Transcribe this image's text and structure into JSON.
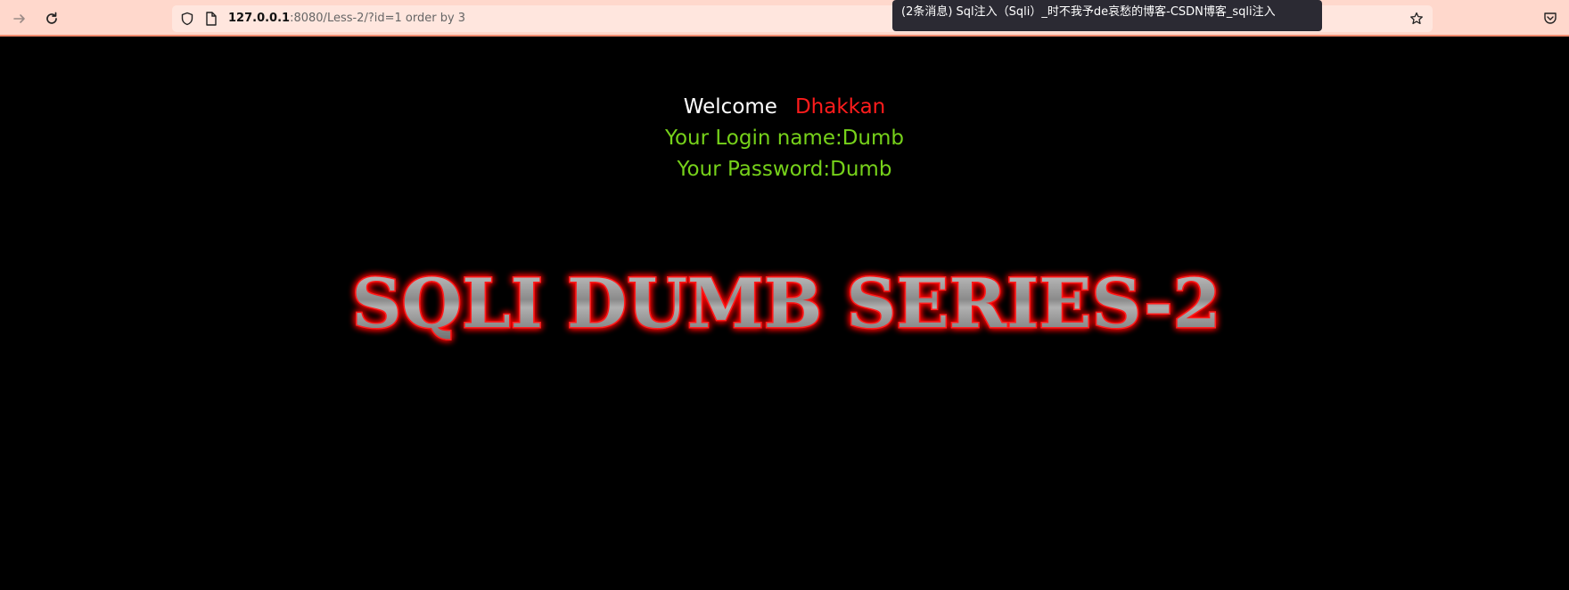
{
  "browser": {
    "url_host": "127.0.0.1",
    "url_rest": ":8080/Less-2/?id=1 order by 3",
    "tooltip": "(2条消息) Sql注入（Sqli）_时不我予de哀愁的博客-CSDN博客_sqli注入",
    "icons": [
      "forward-arrow-icon",
      "reload-icon",
      "shield-icon",
      "page-icon",
      "bookmark-star-icon",
      "pocket-icon"
    ]
  },
  "page": {
    "welcome_label": "Welcome",
    "welcome_name": "Dhakkan",
    "login_line": "Your Login name:Dumb",
    "password_line": "Your Password:Dumb",
    "banner_text": "SQLI DUMB SERIES-2",
    "colors": {
      "background": "#000000",
      "name": "#ff1c1c",
      "info": "#76d11a",
      "banner_glow": "#ff0000"
    }
  }
}
